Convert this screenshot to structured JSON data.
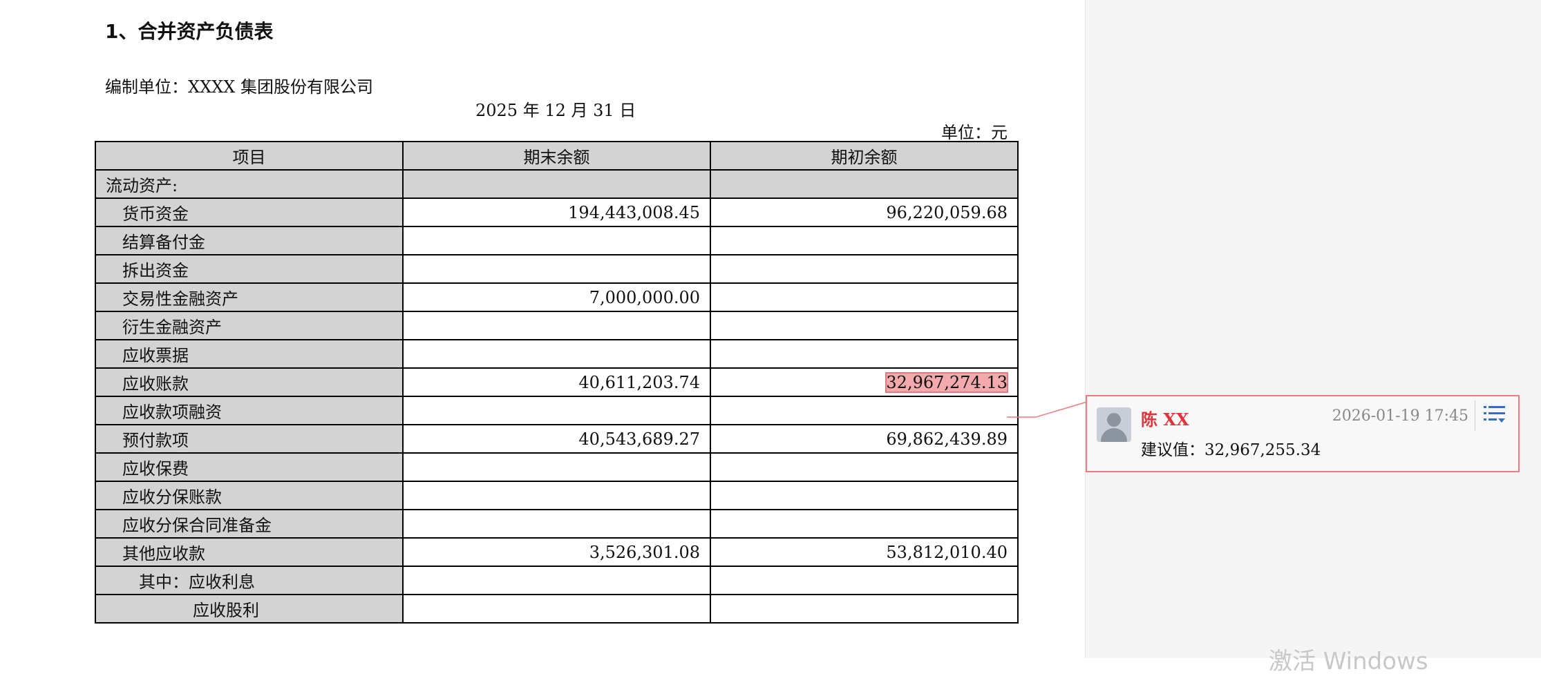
{
  "document": {
    "heading": "1、合并资产负债表",
    "company": "编制单位：XXXX 集团股份有限公司",
    "date": "2025 年 12 月 31 日",
    "unit": "单位：元"
  },
  "table": {
    "headers": [
      "项目",
      "期末余额",
      "期初余额"
    ],
    "section_label": "流动资产:",
    "rows": [
      {
        "label": "货币资金",
        "end": "194,443,008.45",
        "begin": "96,220,059.68"
      },
      {
        "label": "结算备付金",
        "end": "",
        "begin": ""
      },
      {
        "label": "拆出资金",
        "end": "",
        "begin": ""
      },
      {
        "label": "交易性金融资产",
        "end": "7,000,000.00",
        "begin": ""
      },
      {
        "label": "衍生金融资产",
        "end": "",
        "begin": ""
      },
      {
        "label": "应收票据",
        "end": "",
        "begin": ""
      },
      {
        "label": "应收账款",
        "end": "40,611,203.74",
        "begin": "32,967,274.13"
      },
      {
        "label": "应收款项融资",
        "end": "",
        "begin": ""
      },
      {
        "label": "预付款项",
        "end": "40,543,689.27",
        "begin": "69,862,439.89"
      },
      {
        "label": "应收保费",
        "end": "",
        "begin": ""
      },
      {
        "label": "应收分保账款",
        "end": "",
        "begin": ""
      },
      {
        "label": "应收分保合同准备金",
        "end": "",
        "begin": ""
      },
      {
        "label": "其他应收款",
        "end": "3,526,301.08",
        "begin": "53,812,010.40"
      },
      {
        "label": "其中：应收利息",
        "end": "",
        "begin": ""
      },
      {
        "label": "应收股利",
        "end": "",
        "begin": ""
      }
    ]
  },
  "comment": {
    "author": "陈 XX",
    "timestamp": "2026-01-19 17:45",
    "text": "建议值：32,967,255.34",
    "menu_icon": "list-menu-icon"
  },
  "watermark": "激活 Windows",
  "colors": {
    "highlight": "#f4a9ac",
    "comment_border": "#f07a7f",
    "author": "#e0343c",
    "menu_icon": "#2f6fc4"
  }
}
